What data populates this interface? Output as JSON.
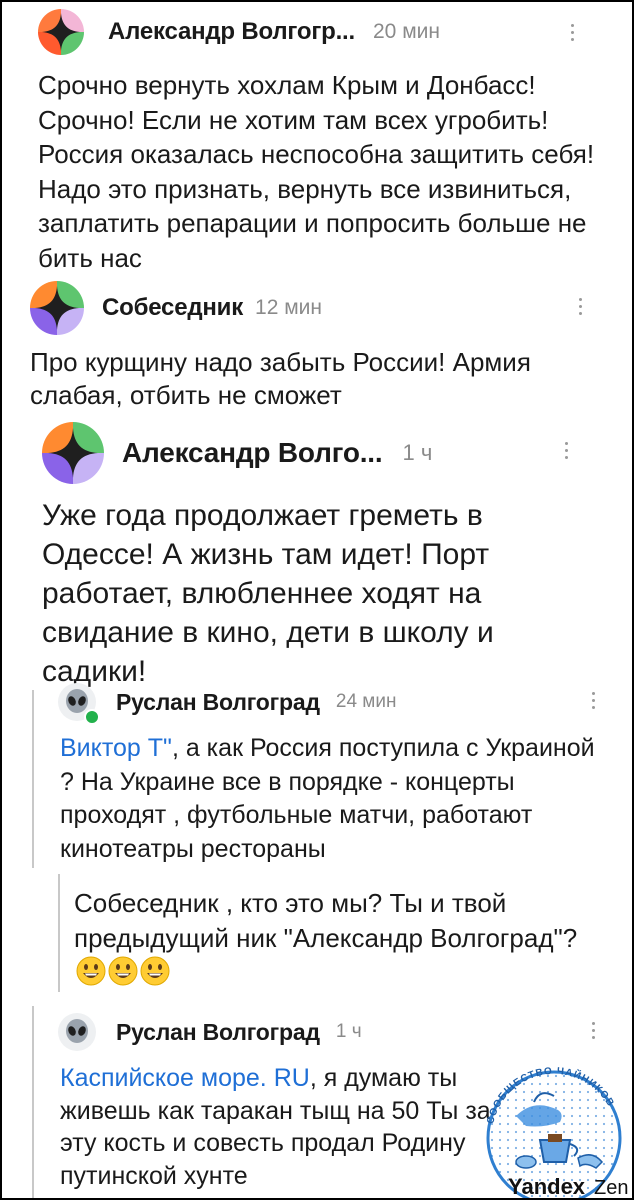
{
  "comments": [
    {
      "author": "Александр Волгогр...",
      "time": "20 мин",
      "text": "Срочно вернуть хохлам Крым и Донбасс! Срочно! Если не хотим там всех угробить! Россия оказалась неспособна защитить себя! Надо это признать, вернуть все извиниться, заплатить репарации и попросить больше не бить нас"
    },
    {
      "author": "Собеседник",
      "time": "12 мин",
      "text": "Про курщину надо забыть России! Армия слабая, отбить не сможет"
    },
    {
      "author": "Александр Волго...",
      "time": "1 ч",
      "text": "Уже года продолжает греметь в Одессе! А жизнь там идет! Порт работает, влюбленнее ходят на свидание в кино, дети в школу и садики!"
    },
    {
      "author": "Руслан Волгоград",
      "time": "24 мин",
      "mention": "Виктор Т\"",
      "text": ", а как Россия поступила с Украиной ? На Украине все в порядке - концерты проходят , футбольные матчи, работают кинотеатры рестораны"
    },
    {
      "text": "Собеседник , кто это мы? Ты и твой предыдущий ник \"Александр Волгоград\"?",
      "emojis": [
        "grinning-face",
        "grinning-face",
        "grinning-face"
      ]
    },
    {
      "author": "Руслан Волгоград",
      "time": "1 ч",
      "mention": "Каспийское море. RU",
      "text": ", я думаю ты живешь как таракан тыщ на 50 Ты за эту кость и совесть продал Родину путинской хунте"
    }
  ],
  "watermark": {
    "ring_text": "СООБЩЕСТВО ЧАЙНИКОВ",
    "brand": "Yandex",
    "brand_suffix": "Zen"
  },
  "colors": {
    "link": "#1f6fd6",
    "meta": "#8a8a8a",
    "online": "#22b14c"
  },
  "icons": {
    "avatar_default": "zen-logo-avatar",
    "avatar_alien": "alien-icon",
    "menu": "kebab-menu-icon"
  }
}
